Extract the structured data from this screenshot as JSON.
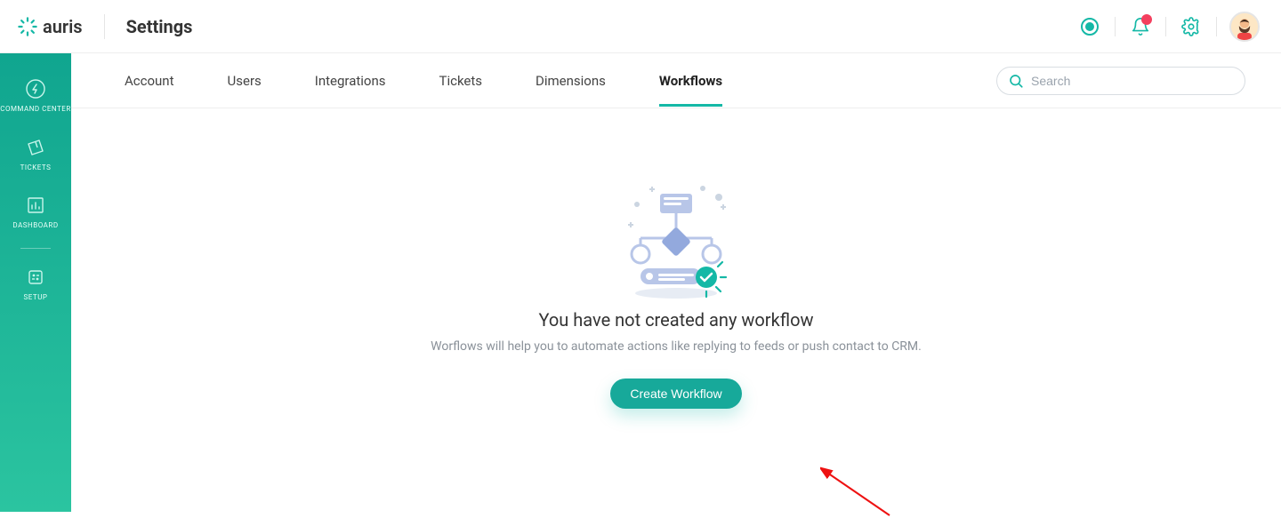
{
  "brand": {
    "name": "auris"
  },
  "page": {
    "title": "Settings"
  },
  "sidebar": {
    "items": [
      {
        "label": "COMMAND CENTER"
      },
      {
        "label": "TICKETS"
      },
      {
        "label": "DASHBOARD"
      },
      {
        "label": "SETUP"
      }
    ]
  },
  "tabs": [
    {
      "label": "Account"
    },
    {
      "label": "Users"
    },
    {
      "label": "Integrations"
    },
    {
      "label": "Tickets"
    },
    {
      "label": "Dimensions"
    },
    {
      "label": "Workflows",
      "active": true
    }
  ],
  "search": {
    "placeholder": "Search",
    "value": ""
  },
  "empty": {
    "title": "You have not created any workflow",
    "subtitle": "Worflows will help you to automate actions like replying to feeds or push contact to CRM.",
    "cta": "Create Workflow"
  },
  "colors": {
    "accent": "#14b8a6"
  }
}
